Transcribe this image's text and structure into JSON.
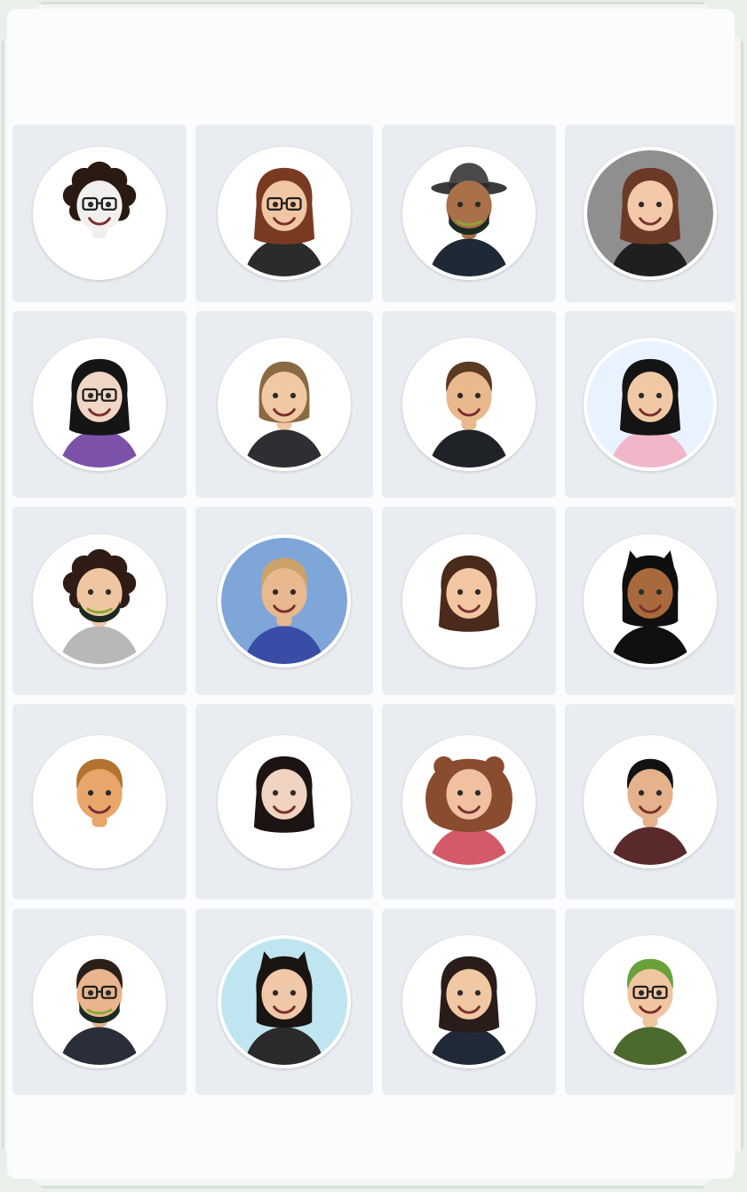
{
  "avatars": [
    {
      "name": "avatar-curly-glasses",
      "skin": "#f2f0ee",
      "hair": "#2a1a12",
      "shirt": "#ffffff",
      "bg": "#ffffff",
      "hairStyle": "curly",
      "glasses": true,
      "mask": false
    },
    {
      "name": "avatar-auburn-hair",
      "skin": "#f1c7a3",
      "hair": "#7a3a22",
      "shirt": "#2b2b2b",
      "bg": "#ffffff",
      "hairStyle": "long",
      "glasses": true,
      "mask": false
    },
    {
      "name": "avatar-hat-mask",
      "skin": "#a9704a",
      "hair": "#3b2a22",
      "shirt": "#1f2835",
      "bg": "#ffffff",
      "hairStyle": "hat",
      "glasses": false,
      "mask": true
    },
    {
      "name": "avatar-grey-bg-long-hair",
      "skin": "#f2c8a8",
      "hair": "#6b3a26",
      "shirt": "#1f1f1f",
      "bg": "#8f8f8f",
      "hairStyle": "long",
      "glasses": false,
      "mask": false
    },
    {
      "name": "avatar-black-hair-purple",
      "skin": "#f0d6c4",
      "hair": "#151515",
      "shirt": "#7c52a8",
      "bg": "#ffffff",
      "hairStyle": "long",
      "glasses": true,
      "mask": false
    },
    {
      "name": "avatar-blonde-bob",
      "skin": "#f0c9a4",
      "hair": "#8a6a42",
      "shirt": "#2d2f33",
      "bg": "#ffffff",
      "hairStyle": "bob",
      "glasses": false,
      "mask": false
    },
    {
      "name": "avatar-boy-brown-hair",
      "skin": "#e9b98d",
      "hair": "#5b3a22",
      "shirt": "#1f2227",
      "bg": "#ffffff",
      "hairStyle": "short",
      "glasses": false,
      "mask": false
    },
    {
      "name": "avatar-snow-angel",
      "skin": "#f0c9a4",
      "hair": "#141414",
      "shirt": "#f2b6c9",
      "bg": "#e9f3ff",
      "hairStyle": "long",
      "glasses": false,
      "mask": false
    },
    {
      "name": "avatar-curly-mask",
      "skin": "#f0c6a2",
      "hair": "#2f1c14",
      "shirt": "#b8b8b8",
      "bg": "#ffffff",
      "hairStyle": "curly",
      "glasses": false,
      "mask": true
    },
    {
      "name": "avatar-winter-fullbody",
      "skin": "#e8b88f",
      "hair": "#caa26a",
      "shirt": "#3a4da6",
      "bg": "#7fa6d8",
      "hairStyle": "short",
      "glasses": false,
      "mask": false
    },
    {
      "name": "avatar-brunette",
      "skin": "#f1c6a1",
      "hair": "#4a2a1a",
      "shirt": "#ffffff",
      "bg": "#ffffff",
      "hairStyle": "long",
      "glasses": false,
      "mask": false
    },
    {
      "name": "avatar-cat-ears",
      "skin": "#a86a3c",
      "hair": "#0f0f0f",
      "shirt": "#101010",
      "bg": "#ffffff",
      "hairStyle": "catears",
      "glasses": false,
      "mask": false
    },
    {
      "name": "avatar-ginger-man",
      "skin": "#e9a66b",
      "hair": "#b1732d",
      "shirt": "#ffffff",
      "bg": "#ffffff",
      "hairStyle": "short",
      "glasses": false,
      "mask": false
    },
    {
      "name": "avatar-winking-girl",
      "skin": "#f0d3c1",
      "hair": "#1c1412",
      "shirt": "#ffffff",
      "bg": "#ffffff",
      "hairStyle": "long",
      "glasses": false,
      "mask": false
    },
    {
      "name": "avatar-bear-hood",
      "skin": "#f0c0a0",
      "hair": "#8a4c2e",
      "shirt": "#d45a6a",
      "bg": "#ffffff",
      "hairStyle": "hood",
      "glasses": false,
      "mask": false
    },
    {
      "name": "avatar-dark-hair-boy",
      "skin": "#e5b28d",
      "hair": "#121212",
      "shirt": "#5a2a2a",
      "bg": "#ffffff",
      "hairStyle": "short",
      "glasses": false,
      "mask": false
    },
    {
      "name": "avatar-glasses-beard-mask",
      "skin": "#e9b48e",
      "hair": "#2b1f18",
      "shirt": "#2a2d3a",
      "bg": "#ffffff",
      "hairStyle": "short",
      "glasses": true,
      "mask": true
    },
    {
      "name": "avatar-cat-ears-teal-bg",
      "skin": "#f0c7a7",
      "hair": "#1a1412",
      "shirt": "#2a2a2a",
      "bg": "#bfe6f0",
      "hairStyle": "catears",
      "glasses": false,
      "mask": false
    },
    {
      "name": "avatar-dark-wavy",
      "skin": "#f0c8a4",
      "hair": "#2a1c18",
      "shirt": "#1f2937",
      "bg": "#ffffff",
      "hairStyle": "long",
      "glasses": false,
      "mask": false
    },
    {
      "name": "avatar-green-hair-glasses",
      "skin": "#f0c6a1",
      "hair": "#6aa13a",
      "shirt": "#4c6a2d",
      "bg": "#ffffff",
      "hairStyle": "short",
      "glasses": true,
      "mask": false
    }
  ]
}
